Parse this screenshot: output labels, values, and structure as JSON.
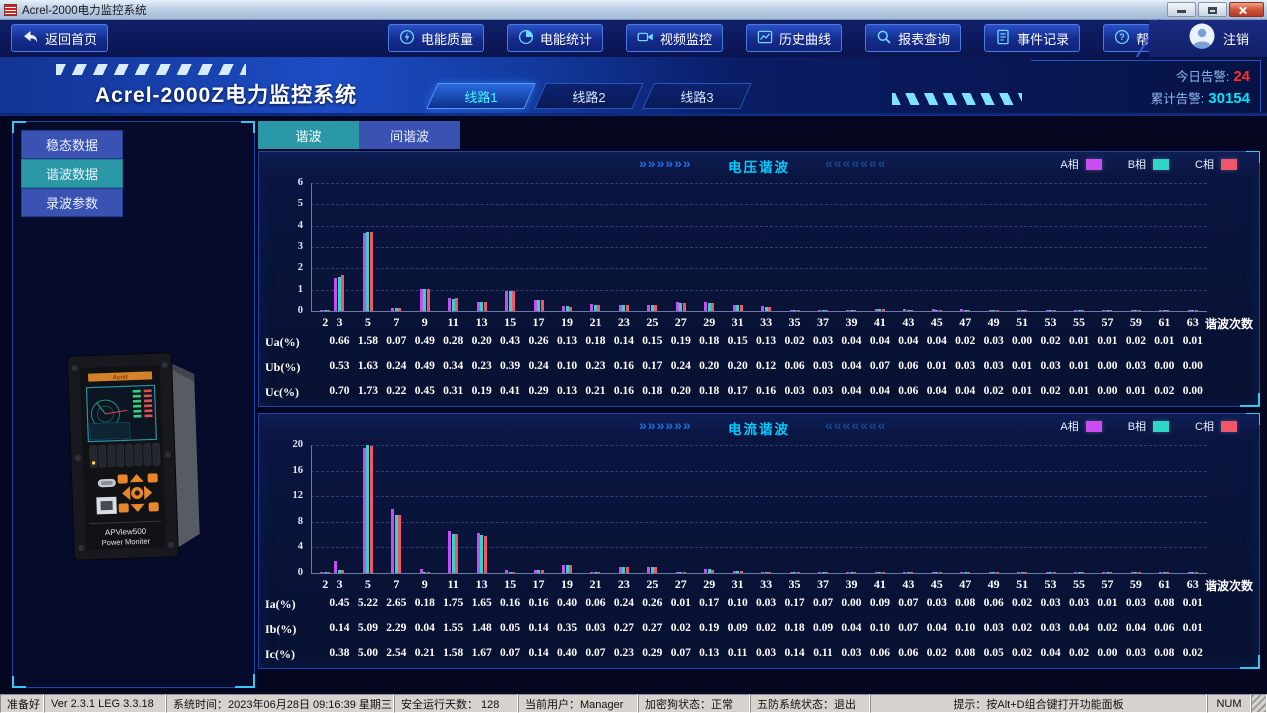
{
  "window": {
    "title": "Acrel-2000电力监控系统"
  },
  "nav": {
    "home": {
      "label": "返回首页",
      "icon": "back-icon"
    },
    "items": [
      {
        "label": "电能质量",
        "icon": "power-quality-icon"
      },
      {
        "label": "电能统计",
        "icon": "energy-stats-icon"
      },
      {
        "label": "视频监控",
        "icon": "video-monitor-icon"
      },
      {
        "label": "历史曲线",
        "icon": "history-curve-icon"
      },
      {
        "label": "报表查询",
        "icon": "report-search-icon"
      },
      {
        "label": "事件记录",
        "icon": "event-log-icon"
      },
      {
        "label": "帮助文档",
        "icon": "help-doc-icon"
      }
    ],
    "logout_label": "注销"
  },
  "header": {
    "title": "Acrel-2000Z电力监控系统",
    "line_tabs": [
      {
        "label": "线路1",
        "active": true
      },
      {
        "label": "线路2",
        "active": false
      },
      {
        "label": "线路3",
        "active": false
      }
    ],
    "alarms": {
      "today_label": "今日告警:",
      "today_value": "24",
      "total_label": "累计告警:",
      "total_value": "30154"
    }
  },
  "sidebar": {
    "items": [
      {
        "label": "稳态数据",
        "active": false
      },
      {
        "label": "谐波数据",
        "active": true
      },
      {
        "label": "录波参数",
        "active": false
      }
    ],
    "device": {
      "line1": "APView500",
      "line2": "Power Moniter",
      "brand": "Acrel"
    }
  },
  "sub_tabs": [
    {
      "label": "谐波",
      "active": true
    },
    {
      "label": "间谐波",
      "active": false
    }
  ],
  "panel_deco": {
    "right_chevrons": "»»»»»»",
    "left_chevrons": "«««««««"
  },
  "legend": {
    "items": [
      {
        "label": "A相",
        "color": "#c94df0"
      },
      {
        "label": "B相",
        "color": "#2fd6c5"
      },
      {
        "label": "C相",
        "color": "#f0556a"
      }
    ]
  },
  "colors": {
    "alarm_today": "#ff2e2e",
    "alarm_total": "#00e4ff",
    "panel_title": "#00ccff",
    "phase_a": "#c94df0",
    "phase_b": "#2fd6c5",
    "phase_c": "#f0556a"
  },
  "chart_data": [
    {
      "type": "bar",
      "title": "电压谐波",
      "xlabel": "谐波次数",
      "ylim": [
        0,
        6
      ],
      "yticks": [
        0,
        1,
        2,
        3,
        4,
        5,
        6
      ],
      "grid": "dashed-horizontal",
      "legend_position": "top-right",
      "x": [
        2,
        3,
        5,
        7,
        9,
        11,
        13,
        15,
        17,
        19,
        21,
        23,
        25,
        27,
        29,
        31,
        33,
        35,
        37,
        39,
        41,
        43,
        45,
        47,
        49,
        51,
        53,
        55,
        57,
        59,
        61,
        63
      ],
      "x_labels": [
        "2",
        "3",
        "5",
        "7",
        "9",
        "11",
        "13",
        "15",
        "17",
        "19",
        "21",
        "23",
        "25",
        "27",
        "29",
        "31",
        "33",
        "35",
        "37",
        "39",
        "41",
        "43",
        "45",
        "47",
        "49",
        "51",
        "53",
        "55",
        "57",
        "59",
        "61",
        "63"
      ],
      "series": [
        {
          "name": "A相",
          "values": [
            0.05,
            1.55,
            3.65,
            0.12,
            1.05,
            0.6,
            0.42,
            0.95,
            0.52,
            0.22,
            0.32,
            0.28,
            0.3,
            0.4,
            0.4,
            0.28,
            0.22,
            0.06,
            0.05,
            0.06,
            0.08,
            0.08,
            0.08,
            0.08,
            0.06,
            0.04,
            0.04,
            0.04,
            0.04,
            0.03,
            0.03,
            0.03
          ]
        },
        {
          "name": "B相",
          "values": [
            0.05,
            1.6,
            3.68,
            0.15,
            1.05,
            0.58,
            0.4,
            0.93,
            0.5,
            0.22,
            0.3,
            0.28,
            0.3,
            0.38,
            0.38,
            0.28,
            0.2,
            0.05,
            0.05,
            0.05,
            0.08,
            0.07,
            0.07,
            0.06,
            0.06,
            0.04,
            0.04,
            0.03,
            0.03,
            0.03,
            0.03,
            0.02
          ]
        },
        {
          "name": "C相",
          "values": [
            0.05,
            1.7,
            3.7,
            0.12,
            1.02,
            0.6,
            0.4,
            0.95,
            0.5,
            0.2,
            0.3,
            0.28,
            0.3,
            0.38,
            0.38,
            0.28,
            0.2,
            0.05,
            0.04,
            0.05,
            0.08,
            0.07,
            0.06,
            0.06,
            0.06,
            0.04,
            0.03,
            0.03,
            0.03,
            0.03,
            0.02,
            0.02
          ]
        }
      ],
      "table": {
        "rows": [
          {
            "label": "Ua(%)",
            "values": [
              "0.66",
              "1.58",
              "0.07",
              "0.49",
              "0.28",
              "0.20",
              "0.43",
              "0.26",
              "0.13",
              "0.18",
              "0.14",
              "0.15",
              "0.19",
              "0.18",
              "0.15",
              "0.13",
              "0.02",
              "0.03",
              "0.04",
              "0.04",
              "0.04",
              "0.04",
              "0.02",
              "0.03",
              "0.00",
              "0.02",
              "0.01",
              "0.01",
              "0.02",
              "0.01",
              "0.01"
            ]
          },
          {
            "label": "Ub(%)",
            "values": [
              "0.53",
              "1.63",
              "0.24",
              "0.49",
              "0.34",
              "0.23",
              "0.39",
              "0.24",
              "0.10",
              "0.23",
              "0.16",
              "0.17",
              "0.24",
              "0.20",
              "0.20",
              "0.12",
              "0.06",
              "0.03",
              "0.04",
              "0.07",
              "0.06",
              "0.01",
              "0.03",
              "0.03",
              "0.01",
              "0.03",
              "0.01",
              "0.00",
              "0.03",
              "0.00",
              "0.00"
            ]
          },
          {
            "label": "Uc(%)",
            "values": [
              "0.70",
              "1.73",
              "0.22",
              "0.45",
              "0.31",
              "0.19",
              "0.41",
              "0.29",
              "0.13",
              "0.21",
              "0.16",
              "0.18",
              "0.20",
              "0.18",
              "0.17",
              "0.16",
              "0.03",
              "0.03",
              "0.04",
              "0.04",
              "0.06",
              "0.04",
              "0.04",
              "0.02",
              "0.01",
              "0.02",
              "0.01",
              "0.00",
              "0.01",
              "0.02",
              "0.00"
            ]
          }
        ]
      }
    },
    {
      "type": "bar",
      "title": "电流谐波",
      "xlabel": "谐波次数",
      "ylim": [
        0,
        20
      ],
      "yticks": [
        0,
        4,
        8,
        12,
        16,
        20
      ],
      "grid": "dashed-horizontal",
      "legend_position": "top-right",
      "x": [
        2,
        3,
        5,
        7,
        9,
        11,
        13,
        15,
        17,
        19,
        21,
        23,
        25,
        27,
        29,
        31,
        33,
        35,
        37,
        39,
        41,
        43,
        45,
        47,
        49,
        51,
        53,
        55,
        57,
        59,
        61,
        63
      ],
      "x_labels": [
        "2",
        "3",
        "5",
        "7",
        "9",
        "11",
        "13",
        "15",
        "17",
        "19",
        "21",
        "23",
        "25",
        "27",
        "29",
        "31",
        "33",
        "35",
        "37",
        "39",
        "41",
        "43",
        "45",
        "47",
        "49",
        "51",
        "53",
        "55",
        "57",
        "59",
        "61",
        "63"
      ],
      "series": [
        {
          "name": "A相",
          "values": [
            0.1,
            1.8,
            19.5,
            10.0,
            0.7,
            6.6,
            6.2,
            0.5,
            0.45,
            1.3,
            0.15,
            1.0,
            1.0,
            0.1,
            0.6,
            0.3,
            0.12,
            0.06,
            0.05,
            0.06,
            0.2,
            0.15,
            0.1,
            0.2,
            0.2,
            0.06,
            0.05,
            0.05,
            0.05,
            0.06,
            0.05,
            0.05
          ]
        },
        {
          "name": "B相",
          "values": [
            0.1,
            0.45,
            20.0,
            9.0,
            0.1,
            6.1,
            5.9,
            0.1,
            0.5,
            1.3,
            0.1,
            0.9,
            0.9,
            0.1,
            0.55,
            0.3,
            0.1,
            0.05,
            0.05,
            0.05,
            0.15,
            0.12,
            0.08,
            0.15,
            0.15,
            0.05,
            0.05,
            0.04,
            0.04,
            0.05,
            0.04,
            0.04
          ]
        },
        {
          "name": "C相",
          "values": [
            0.1,
            0.4,
            19.8,
            9.0,
            0.1,
            6.1,
            5.8,
            0.1,
            0.45,
            1.2,
            0.1,
            0.9,
            0.9,
            0.1,
            0.5,
            0.3,
            0.1,
            0.05,
            0.04,
            0.05,
            0.15,
            0.12,
            0.08,
            0.15,
            0.15,
            0.05,
            0.04,
            0.04,
            0.04,
            0.05,
            0.04,
            0.04
          ]
        }
      ],
      "table": {
        "rows": [
          {
            "label": "Ia(%)",
            "values": [
              "0.45",
              "5.22",
              "2.65",
              "0.18",
              "1.75",
              "1.65",
              "0.16",
              "0.16",
              "0.40",
              "0.06",
              "0.24",
              "0.26",
              "0.01",
              "0.17",
              "0.10",
              "0.03",
              "0.17",
              "0.07",
              "0.00",
              "0.09",
              "0.07",
              "0.03",
              "0.08",
              "0.06",
              "0.02",
              "0.03",
              "0.03",
              "0.01",
              "0.03",
              "0.08",
              "0.01"
            ]
          },
          {
            "label": "Ib(%)",
            "values": [
              "0.14",
              "5.09",
              "2.29",
              "0.04",
              "1.55",
              "1.48",
              "0.05",
              "0.14",
              "0.35",
              "0.03",
              "0.27",
              "0.27",
              "0.02",
              "0.19",
              "0.09",
              "0.02",
              "0.18",
              "0.09",
              "0.04",
              "0.10",
              "0.07",
              "0.04",
              "0.10",
              "0.03",
              "0.02",
              "0.03",
              "0.04",
              "0.02",
              "0.04",
              "0.06",
              "0.01"
            ]
          },
          {
            "label": "Ic(%)",
            "values": [
              "0.38",
              "5.00",
              "2.54",
              "0.21",
              "1.58",
              "1.67",
              "0.07",
              "0.14",
              "0.40",
              "0.07",
              "0.23",
              "0.29",
              "0.07",
              "0.13",
              "0.11",
              "0.03",
              "0.14",
              "0.11",
              "0.03",
              "0.06",
              "0.06",
              "0.02",
              "0.08",
              "0.05",
              "0.02",
              "0.04",
              "0.02",
              "0.00",
              "0.03",
              "0.08",
              "0.02"
            ]
          }
        ]
      }
    }
  ],
  "statusbar": {
    "segments": [
      "准备好",
      "Ver 2.3.1 LEG 3.3.18",
      "系统时间：2023年06月28日  09:16:39  星期三",
      "安全运行天数：  128",
      "当前用户：Manager",
      "加密狗状态：正常",
      "五防系统状态：退出"
    ],
    "tip": "提示：按Alt+D组合键打开功能面板",
    "num": "NUM"
  }
}
